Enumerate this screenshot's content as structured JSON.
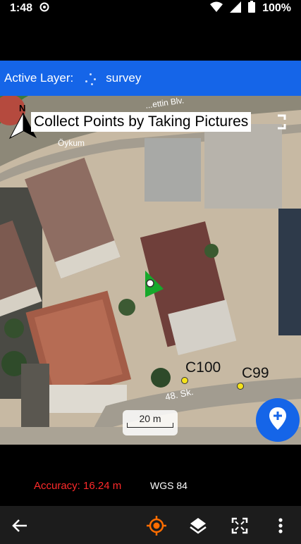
{
  "status_bar": {
    "time": "1:48",
    "battery": "100%",
    "icons": [
      "notification-icon",
      "wifi-icon",
      "signal-icon",
      "battery-icon"
    ]
  },
  "layer_bar": {
    "label": "Active Layer:",
    "layer_name": "survey",
    "color": "#1565e8"
  },
  "map": {
    "title": "Collect Points by Taking Pictures",
    "north_label": "N",
    "street_labels": [
      "...ettin Blv.",
      "Öykum",
      "48. Sk."
    ],
    "scale_label": "20 m",
    "points": [
      "C100",
      "C99"
    ],
    "point_color": "#f5e21a",
    "gps_color": "#16a82b"
  },
  "info": {
    "accuracy": "Accuracy: 16.24 m",
    "accuracy_color": "#ff2a2a",
    "crs": "WGS 84"
  },
  "toolbar": {
    "items": [
      "back-icon",
      "gps-locate-icon",
      "layers-icon",
      "fullscreen-icon",
      "more-icon"
    ],
    "accent": "#ff6d00"
  }
}
